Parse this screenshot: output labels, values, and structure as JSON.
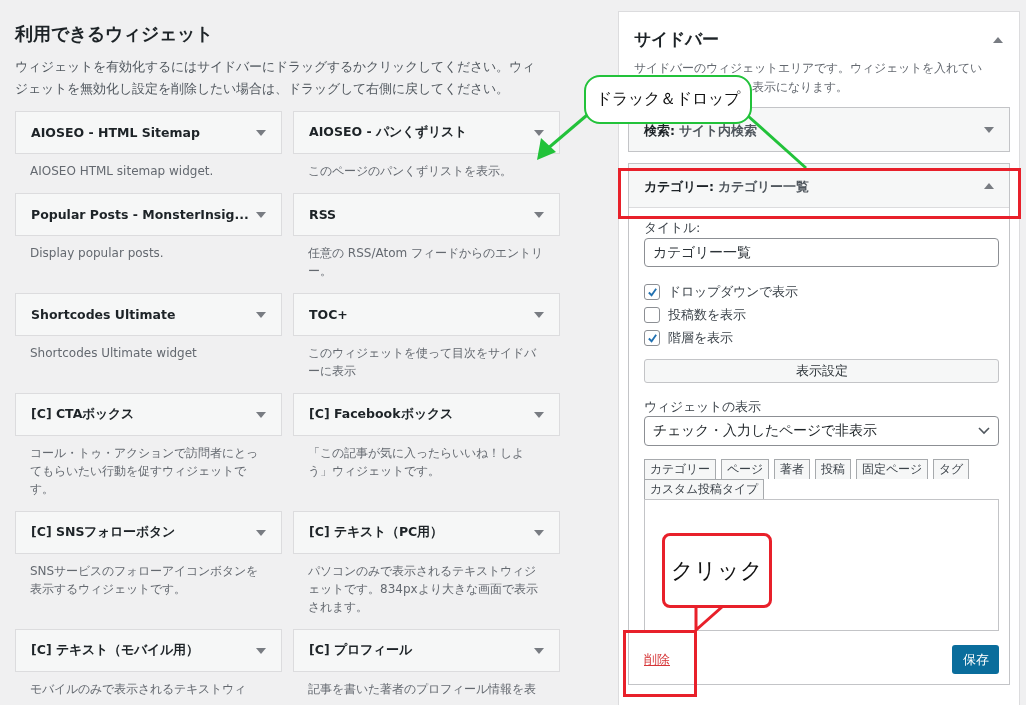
{
  "available": {
    "title": "利用できるウィジェット",
    "description": "ウィジェットを有効化するにはサイドバーにドラッグするかクリックしてください。ウィジェットを無効化し設定を削除したい場合は、ドラッグして右側に戻してください。",
    "widgets": [
      {
        "name": "AIOSEO - HTML Sitemap",
        "description": "AIOSEO HTML sitemap widget."
      },
      {
        "name": "AIOSEO - パンくずリスト",
        "description": "このページのパンくずリストを表示。"
      },
      {
        "name": "Popular Posts - MonsterInsig...",
        "description": "Display popular posts."
      },
      {
        "name": "RSS",
        "description": "任意の RSS/Atom フィードからのエントリー。"
      },
      {
        "name": "Shortcodes Ultimate",
        "description": "Shortcodes Ultimate widget"
      },
      {
        "name": "TOC+",
        "description": "このウィジェットを使って目次をサイドバーに表示"
      },
      {
        "name": "[C] CTAボックス",
        "description": "コール・トゥ・アクションで訪問者にとってもらいたい行動を促すウィジェットです。"
      },
      {
        "name": "[C] Facebookボックス",
        "description": "「この記事が気に入ったらいいね！しよう」ウィジェットです。"
      },
      {
        "name": "[C] SNSフォローボタン",
        "description": "SNSサービスのフォローアイコンボタンを表示するウィジェットです。"
      },
      {
        "name": "[C] テキスト（PC用）",
        "description": "パソコンのみで表示されるテキストウィジェットです。834pxより大きな画面で表示されます。"
      },
      {
        "name": "[C] テキスト（モバイル用）",
        "description": "モバイルのみで表示されるテキストウィ"
      },
      {
        "name": "[C] プロフィール",
        "description": "記事を書いた著者のプロフィール情報を表"
      }
    ]
  },
  "sidebar": {
    "title": "サイドバー",
    "expanded": true,
    "description_lines": [
      "サイドバーのウィジェットエリアです。ウィジェットを入れてい",
      "表示になります。"
    ],
    "widgets": [
      {
        "type": "検索:",
        "name": "サイト内検索",
        "expanded": false
      },
      {
        "type": "カテゴリー:",
        "name": "カテゴリー一覧",
        "expanded": true
      }
    ],
    "form": {
      "title_label": "タイトル:",
      "title_value": "カテゴリー一覧",
      "checkboxes": [
        {
          "label": "ドロップダウンで表示",
          "checked": true
        },
        {
          "label": "投稿数を表示",
          "checked": false
        },
        {
          "label": "階層を表示",
          "checked": true
        }
      ],
      "display_button": "表示設定",
      "visibility_label": "ウィジェットの表示",
      "visibility_value": "チェック・入力したページで非表示",
      "tabs": [
        {
          "label": "カテゴリー",
          "selected": false
        },
        {
          "label": "ページ",
          "selected": false
        },
        {
          "label": "著者",
          "selected": false
        },
        {
          "label": "投稿",
          "selected": false
        },
        {
          "label": "固定ページ",
          "selected": false
        },
        {
          "label": "タグ",
          "selected": false
        },
        {
          "label": "カスタム投稿タイプ",
          "selected": false
        }
      ],
      "delete_link": "削除",
      "save_button": "保存"
    }
  },
  "annotations": [
    {
      "kind": "drag",
      "text": "ドラック＆ドロップ"
    },
    {
      "kind": "click",
      "text": "クリック"
    }
  ]
}
